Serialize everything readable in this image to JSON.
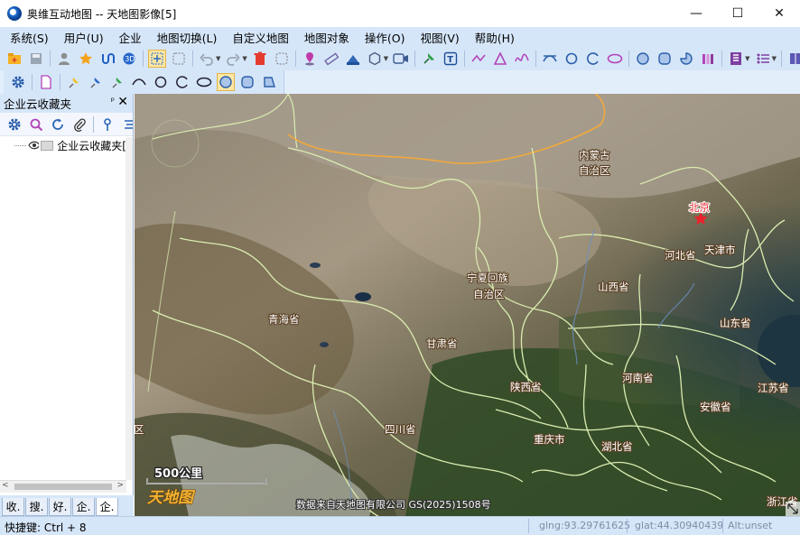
{
  "window": {
    "title": "奥维互动地图 -- 天地图影像[5]",
    "controls": [
      "—",
      "☐",
      "✕"
    ]
  },
  "menu": [
    "系统(S)",
    "用户(U)",
    "企业",
    "地图切换(L)",
    "自定义地图",
    "地图对象",
    "操作(O)",
    "视图(V)",
    "帮助(H)"
  ],
  "panel": {
    "title": "企业云收藏夹",
    "pin": "ᵖ",
    "close": "✕",
    "tree_item": "企业云收藏夹[",
    "bottom_tabs": [
      "收.",
      "搜.",
      "好.",
      "企.",
      "企."
    ]
  },
  "map": {
    "labels": {
      "neimenggu": "内蒙古",
      "neimenggu2": "自治区",
      "beijing": "北京",
      "hebei": "河北省",
      "tianjin": "天津市",
      "ningxia": "宁夏回族",
      "ningxia2": "自治区",
      "shanxi": "山西省",
      "qinghai": "青海省",
      "gansu": "甘肃省",
      "shandong": "山东省",
      "henan": "河南省",
      "shaanxi": "陕西省",
      "jiangsu": "江苏省",
      "anhui": "安徽省",
      "sichuan": "四川省",
      "chongqing": "重庆市",
      "hubei": "湖北省",
      "zhejiang": "浙江省"
    },
    "scale_label": "500公里",
    "logo_text": "天地图",
    "attribution": "数据来自天地图有限公司 GS(2025)1508号",
    "edge_char": "区"
  },
  "status": {
    "shortcut": "快捷键: Ctrl + 8",
    "lng": "glng:93.29761625",
    "lat": "glat:44.30940439",
    "alt": "Alt:unset"
  },
  "colors": {
    "chrome": "#d6e6f9",
    "province_border": "#d9ecb0",
    "national_border": "#f2a93b",
    "capital_star": "#e8232b"
  }
}
